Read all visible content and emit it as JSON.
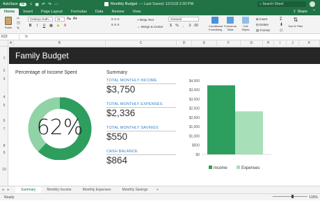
{
  "titlebar": {
    "autosave_label": "AutoSave",
    "autosave_state": "ON",
    "title": "Monthly Budget",
    "subtitle": "— Last Saved: 12/1/18 2:30 PM",
    "search_placeholder": "Search Sheet"
  },
  "tabs": [
    "Home",
    "Insert",
    "Page Layout",
    "Formulas",
    "Data",
    "Review",
    "View"
  ],
  "share_label": "Share",
  "ribbon": {
    "paste": "Paste",
    "font": "Century Goth...",
    "font_size": "11",
    "wrap_text": "Wrap Text",
    "merge_center": "Merge & Center",
    "number_format": "General",
    "conditional": "Conditional Formatting",
    "format_table": "Format as Table",
    "cell_styles": "Cell Styles",
    "insert": "Insert",
    "delete": "Delete",
    "format": "Format",
    "sort_filter": "Sort & Filter"
  },
  "formula_bar": {
    "name_box": "F22",
    "fx": "fx"
  },
  "columns": [
    "A",
    "B",
    "C",
    "D",
    "E",
    "F",
    "G",
    "H",
    "I",
    "J",
    "K"
  ],
  "rows": [
    "1",
    "2",
    "3",
    "4",
    "5",
    "6",
    "7",
    "8",
    "9",
    "10"
  ],
  "sheet": {
    "banner_title": "Family Budget",
    "percent_title": "Percentage of Income Spent",
    "summary_title": "Summary",
    "percent_value": "62%",
    "metrics": [
      {
        "label": "TOTAL MONTHLY INCOME",
        "value": "$3,750"
      },
      {
        "label": "TOTAL MONTHLY EXPENSES",
        "value": "$2,336"
      },
      {
        "label": "TOTAL MONTHLY SAVINGS",
        "value": "$550"
      },
      {
        "label": "CASH BALANCE",
        "value": "$864"
      }
    ]
  },
  "donut": {
    "spent_fraction": 0.62,
    "color_spent": "#2e9e5e",
    "color_remaining": "#8fd3a6"
  },
  "chart_data": {
    "type": "bar",
    "categories": [
      "Income",
      "Expenses"
    ],
    "values": [
      3750,
      2336
    ],
    "colors": [
      "#2e9e5e",
      "#a6dfb8"
    ],
    "ylim": [
      0,
      4000
    ],
    "yticks": [
      "$0",
      "$500",
      "$1,000",
      "$1,500",
      "$2,000",
      "$2,500",
      "$3,000",
      "$3,500",
      "$4,000"
    ],
    "legend": [
      "Income",
      "Expenses"
    ],
    "legend_position": "bottom",
    "grid": false
  },
  "sheet_tabs": [
    "Summary",
    "Monthly Income",
    "Monthly Expenses",
    "Monthly Savings"
  ],
  "status": {
    "ready": "Ready",
    "zoom": "100%"
  }
}
